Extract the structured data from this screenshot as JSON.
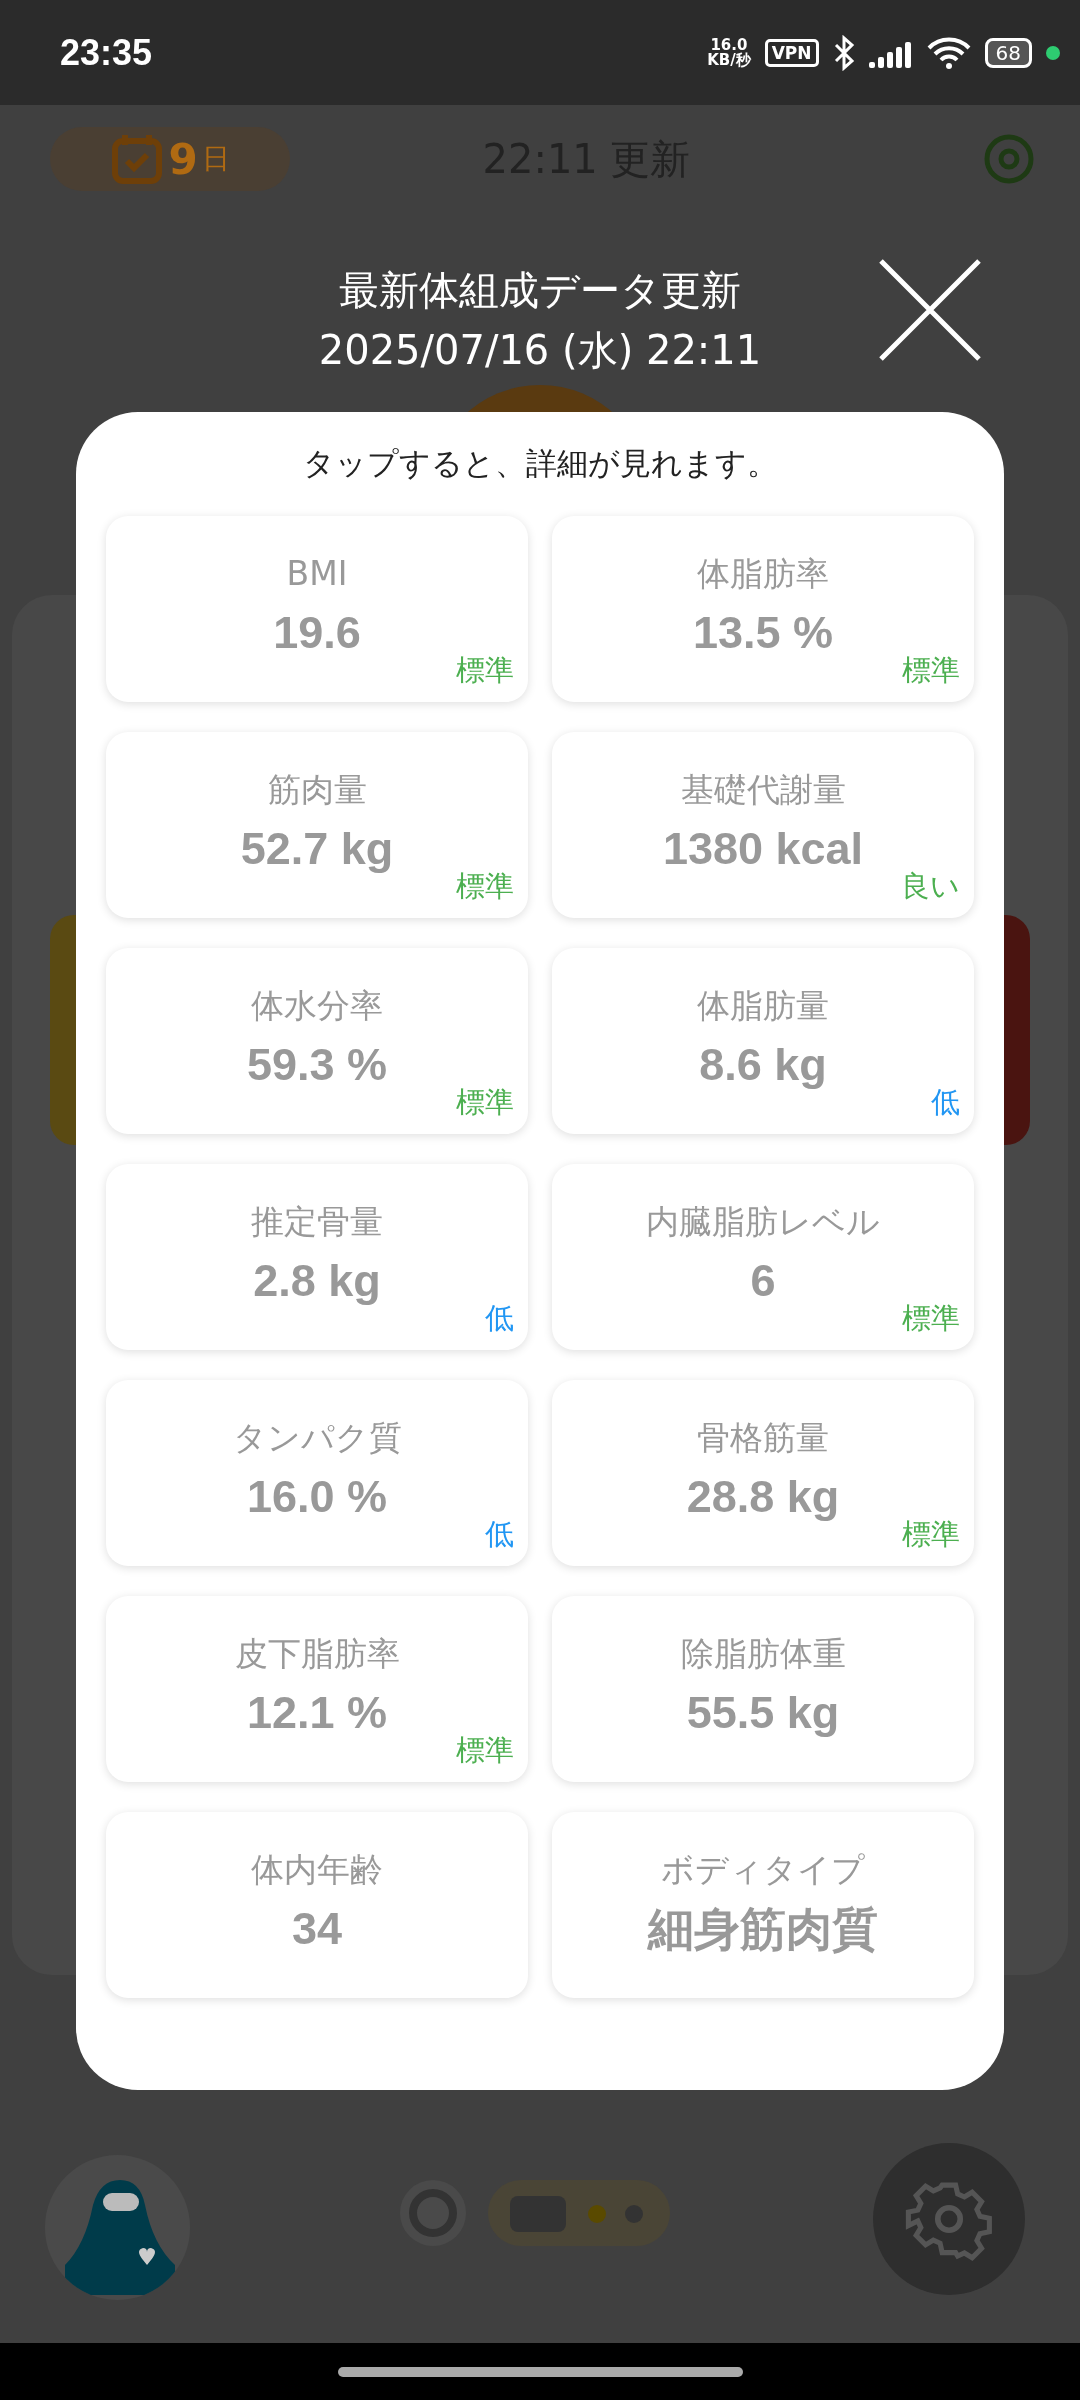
{
  "status_bar": {
    "time": "23:35",
    "net_speed": "16.0",
    "net_unit": "KB/秒",
    "vpn": "VPN",
    "battery": "68"
  },
  "background": {
    "streak": {
      "number": "9",
      "unit": "日"
    },
    "updated": "22:11 更新"
  },
  "dialog": {
    "title": "最新体組成データ更新",
    "timestamp": "2025/07/16 (水) 22:11",
    "hint": "タップすると、詳細が見れます。",
    "metrics": [
      {
        "label": "BMI",
        "value": "19.6",
        "rating": {
          "text": "標準",
          "color": "#4caf50"
        }
      },
      {
        "label": "体脂肪率",
        "value": "13.5 %",
        "rating": {
          "text": "標準",
          "color": "#4caf50"
        }
      },
      {
        "label": "筋肉量",
        "value": "52.7 kg",
        "rating": {
          "text": "標準",
          "color": "#4caf50"
        }
      },
      {
        "label": "基礎代謝量",
        "value": "1380 kcal",
        "rating": {
          "text": "良い",
          "color": "#4caf50"
        }
      },
      {
        "label": "体水分率",
        "value": "59.3 %",
        "rating": {
          "text": "標準",
          "color": "#4caf50"
        }
      },
      {
        "label": "体脂肪量",
        "value": "8.6 kg",
        "rating": {
          "text": "低",
          "color": "#2196f3"
        }
      },
      {
        "label": "推定骨量",
        "value": "2.8 kg",
        "rating": {
          "text": "低",
          "color": "#2196f3"
        }
      },
      {
        "label": "内臓脂肪レベル",
        "value": "6",
        "rating": {
          "text": "標準",
          "color": "#4caf50"
        }
      },
      {
        "label": "タンパク質",
        "value": "16.0 %",
        "rating": {
          "text": "低",
          "color": "#2196f3"
        }
      },
      {
        "label": "骨格筋量",
        "value": "28.8 kg",
        "rating": {
          "text": "標準",
          "color": "#4caf50"
        }
      },
      {
        "label": "皮下脂肪率",
        "value": "12.1 %",
        "rating": {
          "text": "標準",
          "color": "#4caf50"
        }
      },
      {
        "label": "除脂肪体重",
        "value": "55.5 kg"
      },
      {
        "label": "体内年齢",
        "value": "34"
      },
      {
        "label": "ボディタイプ",
        "value": "細身筋肉質",
        "kind": "text"
      }
    ]
  }
}
